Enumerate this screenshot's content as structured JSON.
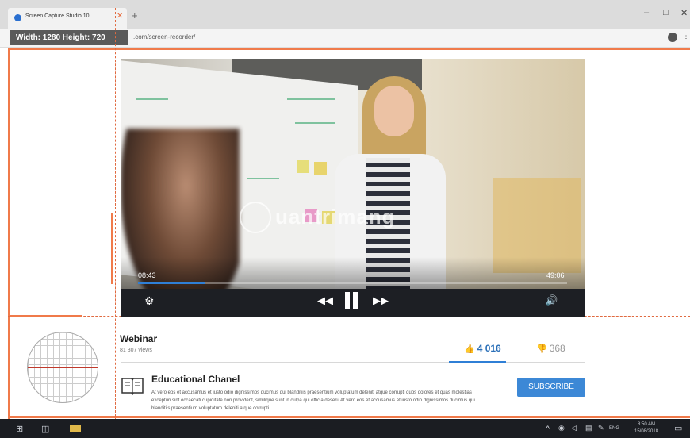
{
  "browser": {
    "tab_title": "Screen Capture Studio 10",
    "tab_close": "✕",
    "new_tab": "+",
    "url": ".com/screen-recorder/",
    "window_controls": [
      "–",
      "□",
      "✕"
    ],
    "menu": "⋮"
  },
  "capture": {
    "dimensions_label": "Width: 1280  Height: 720"
  },
  "video": {
    "watermark": "uantrimang",
    "time_current": "08:43",
    "time_total": "49:06",
    "progress": 0.155,
    "controls": {
      "settings_icon": "⚙",
      "rewind_icon": "◀◀",
      "forward_icon": "▶▶",
      "volume_icon": "🔊"
    }
  },
  "info": {
    "title": "Webinar",
    "views": "81 307 views",
    "likes": "4 016",
    "dislikes": "368",
    "like_icon": "👍",
    "dislike_icon": "👎"
  },
  "channel": {
    "name": "Educational Chanel",
    "description": "At vero eos et accusamus et iusto odio dignissimos ducimus qui blanditiis praesentium voluptatum deleniti atque corrupti quos dolores et quas molestias excepturi sint occaecati cupiditate non provident, similique sunt in culpa qui officia deseru At vero eos et accusamus et iusto odio dignissimos ducimus qui blanditiis praesentium voluptatum deleniti atque corrupti",
    "subscribe_label": "SUBSCRIBE"
  },
  "taskbar": {
    "start_icon": "⊞",
    "task_view_icon": "◫",
    "tray_chevron": "^",
    "language": "ENG",
    "time": "8:50 AM",
    "date": "15/08/2018",
    "notification_icon": "▭"
  },
  "colors": {
    "accent_orange": "#f07a4a",
    "accent_blue": "#2f7fd6",
    "subscribe_bg": "#3c88d6"
  }
}
